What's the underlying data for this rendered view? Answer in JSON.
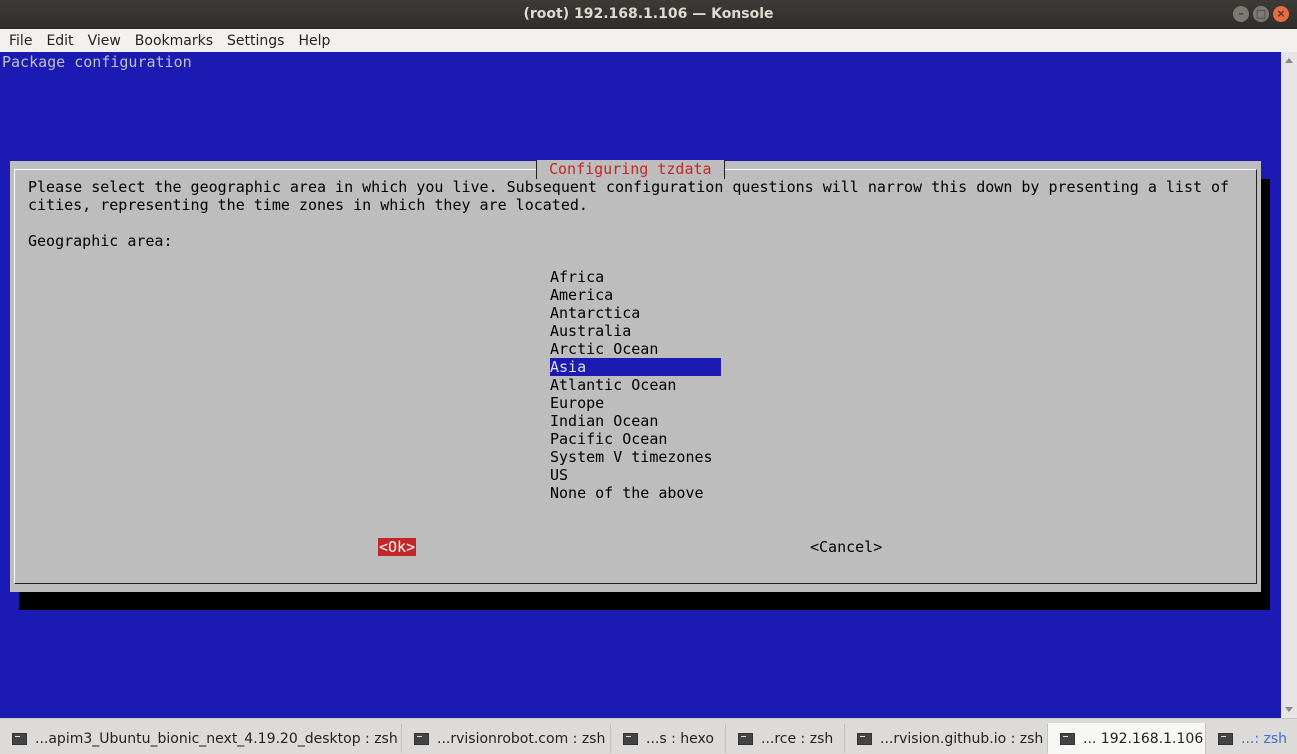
{
  "window": {
    "title": "(root) 192.168.1.106 — Konsole"
  },
  "menubar": {
    "items": [
      "File",
      "Edit",
      "View",
      "Bookmarks",
      "Settings",
      "Help"
    ]
  },
  "terminal": {
    "header": "Package configuration",
    "dialog": {
      "title": "Configuring tzdata",
      "line1": "Please select the geographic area in which you live. Subsequent configuration questions will narrow this down by presenting a list of",
      "line2": "cities, representing the time zones in which they are located.",
      "prompt": "Geographic area:",
      "options": [
        "Africa",
        "America",
        "Antarctica",
        "Australia",
        "Arctic Ocean",
        "Asia",
        "Atlantic Ocean",
        "Europe",
        "Indian Ocean",
        "Pacific Ocean",
        "System V timezones",
        "US",
        "None of the above"
      ],
      "selected": "Asia",
      "ok_label": "<Ok>",
      "cancel_label": "<Cancel>"
    }
  },
  "tabs": [
    {
      "label": "...apim3_Ubuntu_bionic_next_4.19.20_desktop : zsh"
    },
    {
      "label": "...rvisionrobot.com : zsh"
    },
    {
      "label": "...s : hexo"
    },
    {
      "label": "...rce : zsh"
    },
    {
      "label": "...rvision.github.io : zsh"
    },
    {
      "label": "... 192.168.1.106"
    },
    {
      "label": "...: zsh"
    }
  ],
  "colors": {
    "terminal_bg": "#1b1bb3",
    "dialog_bg": "#bdbdbd",
    "accent_red": "#c42727"
  }
}
